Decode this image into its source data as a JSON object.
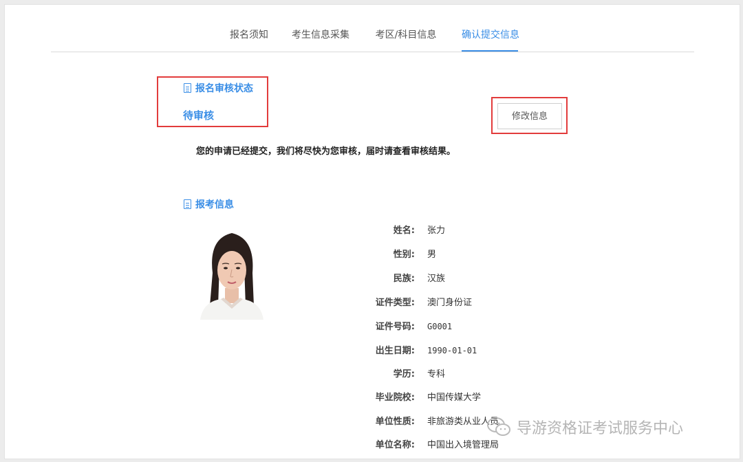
{
  "tabs": [
    {
      "label": "报名须知"
    },
    {
      "label": "考生信息采集"
    },
    {
      "label": "考区/科目信息"
    },
    {
      "label": "确认提交信息",
      "active": true
    }
  ],
  "review": {
    "title": "报名审核状态",
    "status": "待审核",
    "edit_button": "修改信息",
    "notice": "您的申请已经提交，我们将尽快为您审核，届时请查看审核结果。"
  },
  "apply_info": {
    "title": "报考信息",
    "fields": [
      {
        "label": "姓名:",
        "value": "张力"
      },
      {
        "label": "性别:",
        "value": "男"
      },
      {
        "label": "民族:",
        "value": "汉族"
      },
      {
        "label": "证件类型:",
        "value": "澳门身份证"
      },
      {
        "label": "证件号码:",
        "value": "G0001"
      },
      {
        "label": "出生日期:",
        "value": "1990-01-01"
      },
      {
        "label": "学历:",
        "value": "专科"
      },
      {
        "label": "毕业院校:",
        "value": "中国传媒大学"
      },
      {
        "label": "单位性质:",
        "value": "非旅游类从业人员"
      },
      {
        "label": "单位名称:",
        "value": "中国出入境管理局"
      }
    ]
  },
  "watermark": {
    "text": "导游资格证考试服务中心",
    "icon": "wechat-icon"
  },
  "colors": {
    "accent": "#3a8ee6",
    "highlight": "#e23b3b"
  }
}
